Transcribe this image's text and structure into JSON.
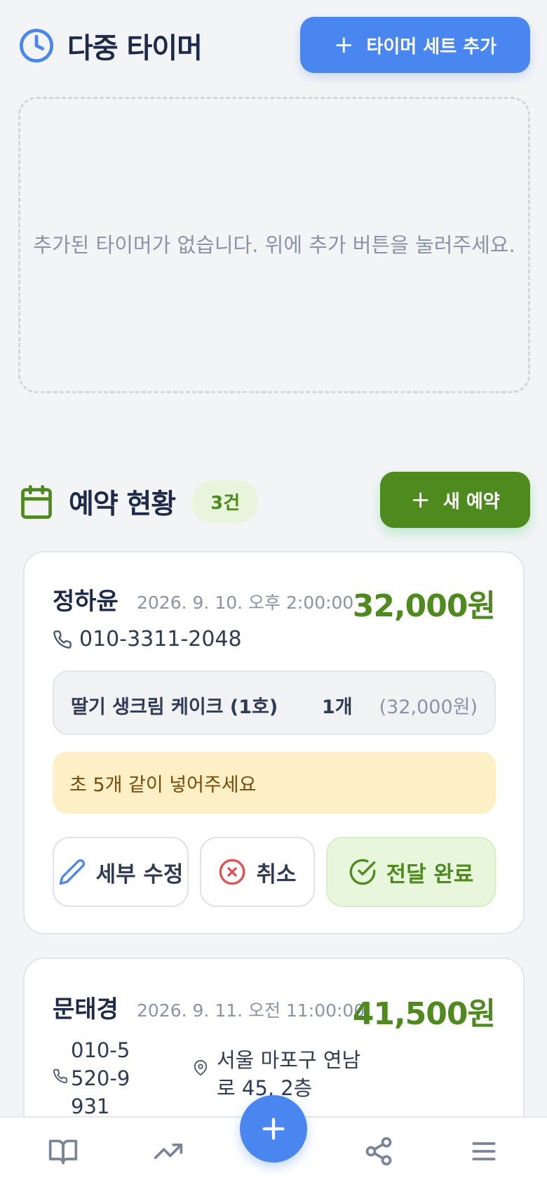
{
  "timers": {
    "title": "다중 타이머",
    "add_button_label": "타이머 세트 추가",
    "empty_message": "추가된 타이머가 없습니다. 위에 추가 버튼을 눌러주세요."
  },
  "reservations": {
    "title": "예약 현황",
    "count_badge": "3건",
    "new_button_label": "새 예약",
    "cards": [
      {
        "name": "정하윤",
        "datetime": "2026. 9. 10. 오후 2:00:00",
        "price": "32,000원",
        "phone": "010-3311-2048",
        "item": {
          "name": "딸기 생크림 케이크 (1호)",
          "qty": "1개",
          "price": "(32,000원)"
        },
        "note": "초 5개 같이 넣어주세요",
        "actions": {
          "edit": "세부 수정",
          "cancel": "취소",
          "done": "전달 완료"
        }
      },
      {
        "name": "문태경",
        "datetime": "2026. 9. 11. 오전 11:00:00",
        "price": "41,500원",
        "phone": "010-5520-9931",
        "address": "서울 마포구 연남로 45, 2층"
      }
    ]
  },
  "colors": {
    "primary_blue": "#4a86f0",
    "primary_green": "#4f8a1f",
    "price_green": "#4e8a1e",
    "note_bg": "#fdf0c6"
  },
  "icons": {
    "timer_header": "clock-icon",
    "reservation_header": "calendar-icon",
    "nav": [
      "book-open-icon",
      "trending-up-icon",
      "plus-icon",
      "share-icon",
      "menu-icon"
    ]
  }
}
